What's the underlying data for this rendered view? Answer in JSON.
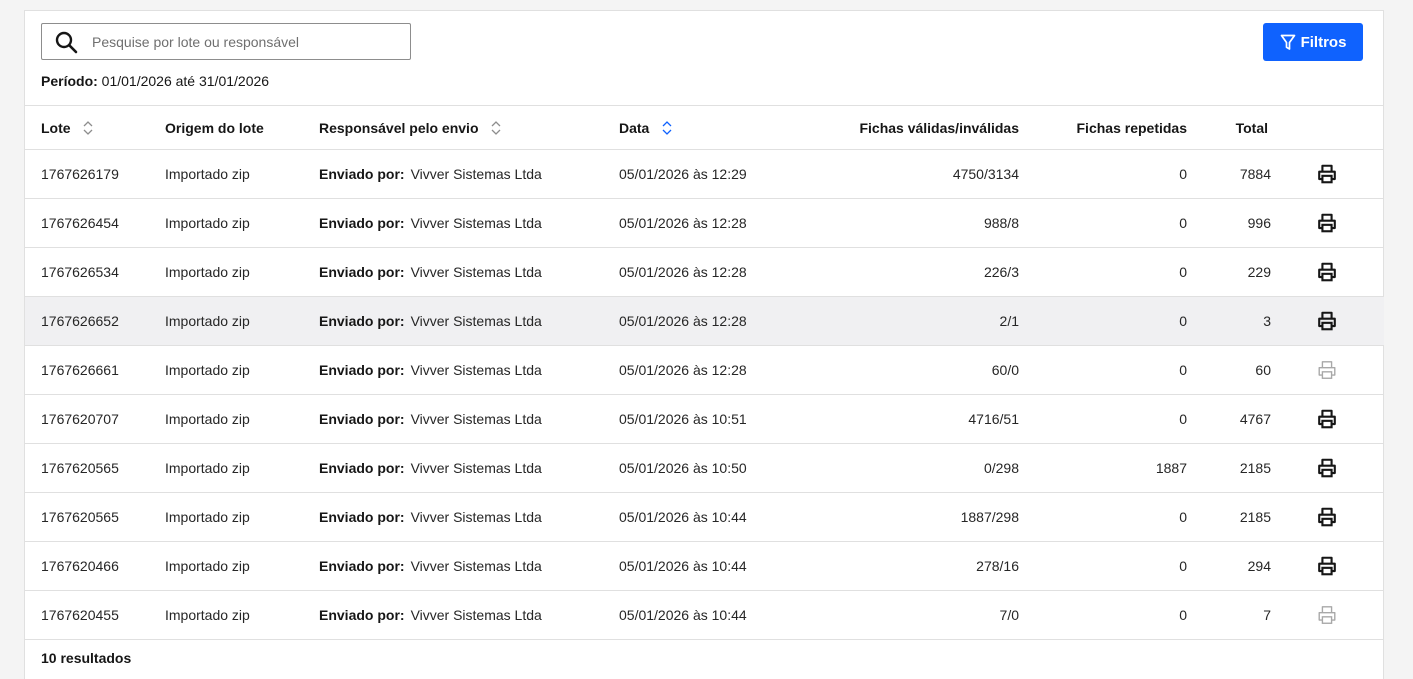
{
  "search": {
    "placeholder": "Pesquise por lote ou responsável",
    "value": ""
  },
  "period": {
    "label": "Período:",
    "value": "01/01/2026 até 31/01/2026"
  },
  "filter_button": {
    "label": "Filtros"
  },
  "table": {
    "headers": {
      "lote": "Lote",
      "origem": "Origem do lote",
      "responsavel": "Responsável pelo envio",
      "data": "Data",
      "fichas_validas": "Fichas válidas/inválidas",
      "fichas_repetidas": "Fichas repetidas",
      "total": "Total"
    },
    "sender_label": "Enviado por:",
    "rows": [
      {
        "lote": "1767626179",
        "origem": "Importado zip",
        "responsavel": "Vivver Sistemas Ltda",
        "data": "05/01/2026 às 12:29",
        "fichas": "4750/3134",
        "repetidas": "0",
        "total": "7884",
        "print_enabled": true
      },
      {
        "lote": "1767626454",
        "origem": "Importado zip",
        "responsavel": "Vivver Sistemas Ltda",
        "data": "05/01/2026 às 12:28",
        "fichas": "988/8",
        "repetidas": "0",
        "total": "996",
        "print_enabled": true
      },
      {
        "lote": "1767626534",
        "origem": "Importado zip",
        "responsavel": "Vivver Sistemas Ltda",
        "data": "05/01/2026 às 12:28",
        "fichas": "226/3",
        "repetidas": "0",
        "total": "229",
        "print_enabled": true
      },
      {
        "lote": "1767626652",
        "origem": "Importado zip",
        "responsavel": "Vivver Sistemas Ltda",
        "data": "05/01/2026 às 12:28",
        "fichas": "2/1",
        "repetidas": "0",
        "total": "3",
        "print_enabled": true
      },
      {
        "lote": "1767626661",
        "origem": "Importado zip",
        "responsavel": "Vivver Sistemas Ltda",
        "data": "05/01/2026 às 12:28",
        "fichas": "60/0",
        "repetidas": "0",
        "total": "60",
        "print_enabled": false
      },
      {
        "lote": "1767620707",
        "origem": "Importado zip",
        "responsavel": "Vivver Sistemas Ltda",
        "data": "05/01/2026 às 10:51",
        "fichas": "4716/51",
        "repetidas": "0",
        "total": "4767",
        "print_enabled": true
      },
      {
        "lote": "1767620565",
        "origem": "Importado zip",
        "responsavel": "Vivver Sistemas Ltda",
        "data": "05/01/2026 às 10:50",
        "fichas": "0/298",
        "repetidas": "1887",
        "total": "2185",
        "print_enabled": true
      },
      {
        "lote": "1767620565",
        "origem": "Importado zip",
        "responsavel": "Vivver Sistemas Ltda",
        "data": "05/01/2026 às 10:44",
        "fichas": "1887/298",
        "repetidas": "0",
        "total": "2185",
        "print_enabled": true
      },
      {
        "lote": "1767620466",
        "origem": "Importado zip",
        "responsavel": "Vivver Sistemas Ltda",
        "data": "05/01/2026 às 10:44",
        "fichas": "278/16",
        "repetidas": "0",
        "total": "294",
        "print_enabled": true
      },
      {
        "lote": "1767620455",
        "origem": "Importado zip",
        "responsavel": "Vivver Sistemas Ltda",
        "data": "05/01/2026 às 10:44",
        "fichas": "7/0",
        "repetidas": "0",
        "total": "7",
        "print_enabled": false
      }
    ]
  },
  "results_count": "10 resultados",
  "icons": {
    "search": "search-icon",
    "filter": "filter-icon",
    "sort": "sort-icon",
    "print": "printer-icon"
  },
  "colors": {
    "primary": "#0f62fe",
    "icon_enabled": "#161616",
    "icon_disabled": "#a8a8a8",
    "row_highlight": "#f0f0f2",
    "sort_icon": "#0f62fe"
  }
}
